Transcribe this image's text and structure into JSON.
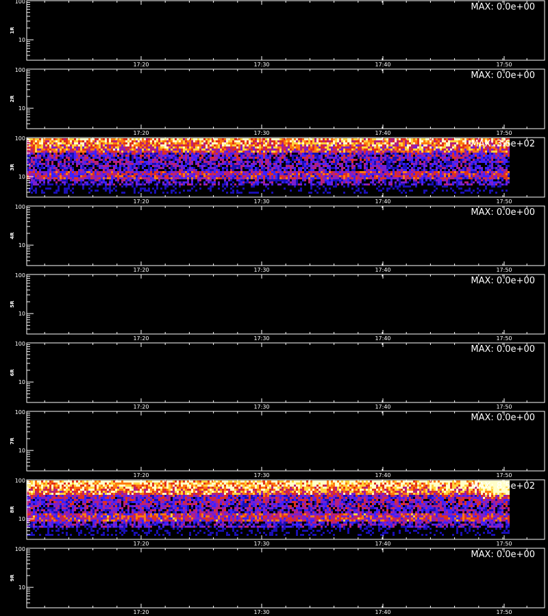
{
  "chart_data": {
    "type": "heatmap",
    "x_ticks": [
      "17:20",
      "17:30",
      "17:40",
      "17:50"
    ],
    "y_scale": "log",
    "y_ticks": [
      "100",
      "10"
    ],
    "ylim": [
      3,
      100
    ],
    "max_prefix": "MAX:",
    "panels": [
      {
        "ylabel": "1R",
        "max_value": "0.0e+00",
        "has_signal": false
      },
      {
        "ylabel": "2R",
        "max_value": "0.0e+00",
        "has_signal": false
      },
      {
        "ylabel": "3R",
        "max_value": "3.6e+02",
        "has_signal": true
      },
      {
        "ylabel": "4R",
        "max_value": "0.0e+00",
        "has_signal": false
      },
      {
        "ylabel": "5R",
        "max_value": "0.0e+00",
        "has_signal": false
      },
      {
        "ylabel": "6R",
        "max_value": "0.0e+00",
        "has_signal": false
      },
      {
        "ylabel": "7R",
        "max_value": "0.0e+00",
        "has_signal": false
      },
      {
        "ylabel": "8R",
        "max_value": "8.5e+02",
        "has_signal": true
      },
      {
        "ylabel": "9R",
        "max_value": "0.0e+00",
        "has_signal": false
      }
    ],
    "colors": {
      "background": "#000000",
      "axis": "#ffffff",
      "colormap": [
        "#000000",
        "#1a0fb4",
        "#3b22ff",
        "#7a1fcf",
        "#b8207a",
        "#e0301c",
        "#ff7a10",
        "#ffd23c",
        "#ffffc8"
      ]
    }
  }
}
